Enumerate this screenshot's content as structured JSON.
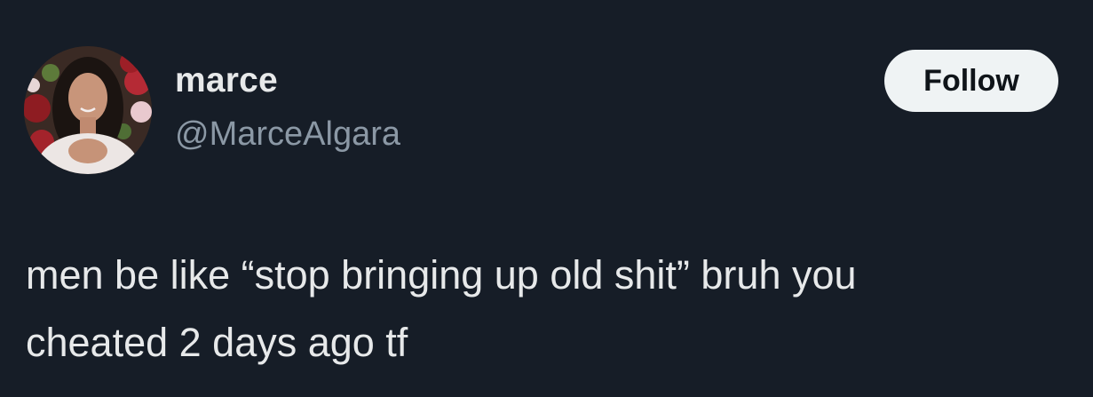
{
  "author": {
    "display_name": "marce",
    "handle": "@MarceAlgara"
  },
  "actions": {
    "follow_label": "Follow"
  },
  "tweet": {
    "text": "men be like “stop bringing up old shit” bruh you\ncheated 2 days ago tf"
  },
  "colors": {
    "background": "#161d27",
    "primary_text": "#e7e9ea",
    "secondary_text": "#8b98a5",
    "follow_button_bg": "#eff3f4",
    "follow_button_text": "#0f1419"
  }
}
